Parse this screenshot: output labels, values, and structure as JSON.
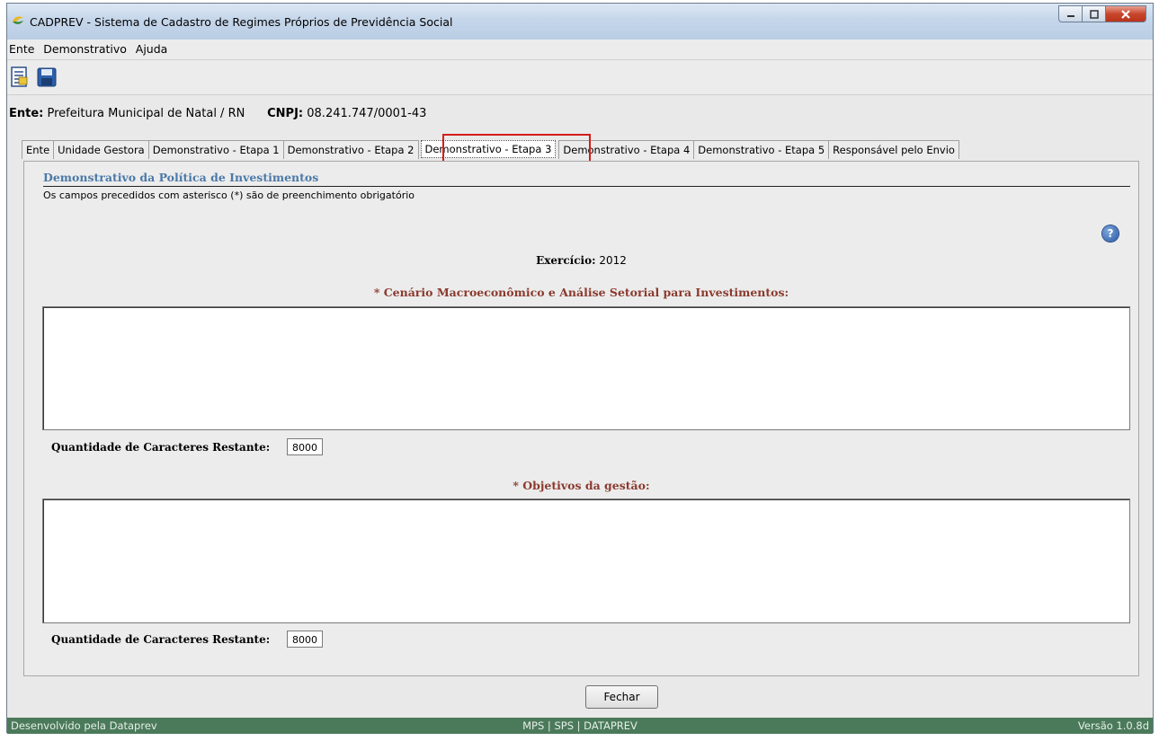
{
  "window": {
    "title": "CADPREV - Sistema de Cadastro de Regimes Próprios de Previdência Social"
  },
  "menu": [
    "Ente",
    "Demonstrativo",
    "Ajuda"
  ],
  "toolbar": {
    "icons": [
      "report-icon",
      "save-icon"
    ]
  },
  "ente": {
    "label": "Ente:",
    "value": "Prefeitura Municipal de Natal / RN",
    "cnpj_label": "CNPJ:",
    "cnpj_value": "08.241.747/0001-43"
  },
  "tabs": [
    "Ente",
    "Unidade Gestora",
    "Demonstrativo - Etapa 1",
    "Demonstrativo - Etapa 2",
    "Demonstrativo - Etapa 3",
    "Demonstrativo - Etapa 4",
    "Demonstrativo - Etapa 5",
    "Responsável pelo Envio"
  ],
  "active_tab": "Demonstrativo - Etapa 3",
  "section": {
    "title": "Demonstrativo da Política de Investimentos",
    "note": "Os campos precedidos com asterisco (*) são de preenchimento obrigatório",
    "exercicio_label": "Exercício:",
    "exercicio_value": "2012"
  },
  "fields": [
    {
      "label": "* Cenário Macroeconômico e Análise Setorial para Investimentos:",
      "value": "",
      "counter_label": "Quantidade de Caracteres Restante:",
      "counter_value": "8000"
    },
    {
      "label": "* Objetivos da gestão:",
      "value": "",
      "counter_label": "Quantidade de Caracteres Restante:",
      "counter_value": "8000"
    }
  ],
  "buttons": {
    "close": "Fechar"
  },
  "status": {
    "left": "Desenvolvido pela Dataprev",
    "center": "MPS | SPS | DATAPREV",
    "right": "Versão 1.0.8d"
  },
  "colors": {
    "section_title": "#4b79a8",
    "field_label": "#8b3a2e",
    "statusbar": "#4b7a5b",
    "tab_highlight": "#d41c1c"
  }
}
